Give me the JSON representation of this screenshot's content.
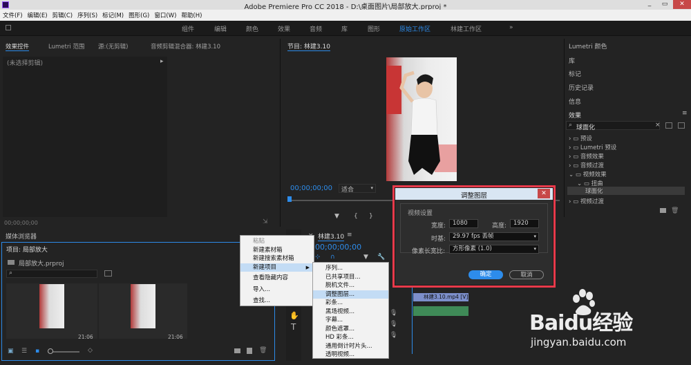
{
  "window": {
    "title": "Adobe Premiere Pro CC 2018 - D:\\桌面图片\\局部放大.prproj *"
  },
  "menubar": [
    "文件(F)",
    "编辑(E)",
    "剪辑(C)",
    "序列(S)",
    "标记(M)",
    "图形(G)",
    "窗口(W)",
    "帮助(H)"
  ],
  "workspaces": [
    "组件",
    "编辑",
    "颜色",
    "效果",
    "音频",
    "库",
    "图形",
    "原始工作区",
    "林建工作区"
  ],
  "workspace_more": "»",
  "source_panel": {
    "tabs": [
      "效果控件",
      "Lumetri 范围",
      "源:(无剪辑)",
      "音频剪辑混合器: 林建3.10"
    ],
    "no_clip": "(未选择剪辑)",
    "timecode": "00;00;00;00"
  },
  "program_monitor": {
    "title": "节目: 林建3.10",
    "timecode": "00;00;00;00",
    "fit": "适合"
  },
  "right_panels": [
    "Lumetri 颜色",
    "库",
    "标记",
    "历史记录",
    "信息",
    "效果"
  ],
  "effects": {
    "search": "球面化",
    "tree": [
      "预设",
      "Lumetri 预设",
      "音频效果",
      "音频过渡",
      "视频效果",
      "扭曲",
      "球面化",
      "视频过渡"
    ]
  },
  "project_panel": {
    "tab_media": "媒体浏览器",
    "title": "项目: 局部放大",
    "file": "局部放大.prproj",
    "duration1": "21:06",
    "duration2": "21:06"
  },
  "timeline": {
    "title": "林建3.10",
    "timecode": "00;00;00;00",
    "clip": "林建3.10.mp4 [V]"
  },
  "context_menu": {
    "items": [
      "粘贴",
      "新建素材箱",
      "新建搜索素材箱",
      "新建项目",
      "查看隐藏内容",
      "导入...",
      "查找..."
    ]
  },
  "submenu": {
    "items": [
      "序列...",
      "已共享项目...",
      "脱机文件...",
      "调整图层...",
      "彩条...",
      "黑场视频...",
      "字幕...",
      "颜色遮罩...",
      "HD 彩条...",
      "通用倒计时片头...",
      "透明视频..."
    ]
  },
  "dialog": {
    "title": "调整图层",
    "group": "视频设置",
    "width_label": "宽度:",
    "width": "1080",
    "height_label": "高度:",
    "height": "1920",
    "timebase_label": "时基:",
    "timebase": "29.97 fps 丢帧",
    "par_label": "像素长宽比:",
    "par": "方形像素 (1.0)",
    "ok": "确定",
    "cancel": "取消"
  },
  "watermark": {
    "brand": "Baidu经验",
    "url": "jingyan.baidu.com"
  },
  "colors": {
    "accent": "#2d8ceb",
    "highlight": "#e8394a"
  }
}
